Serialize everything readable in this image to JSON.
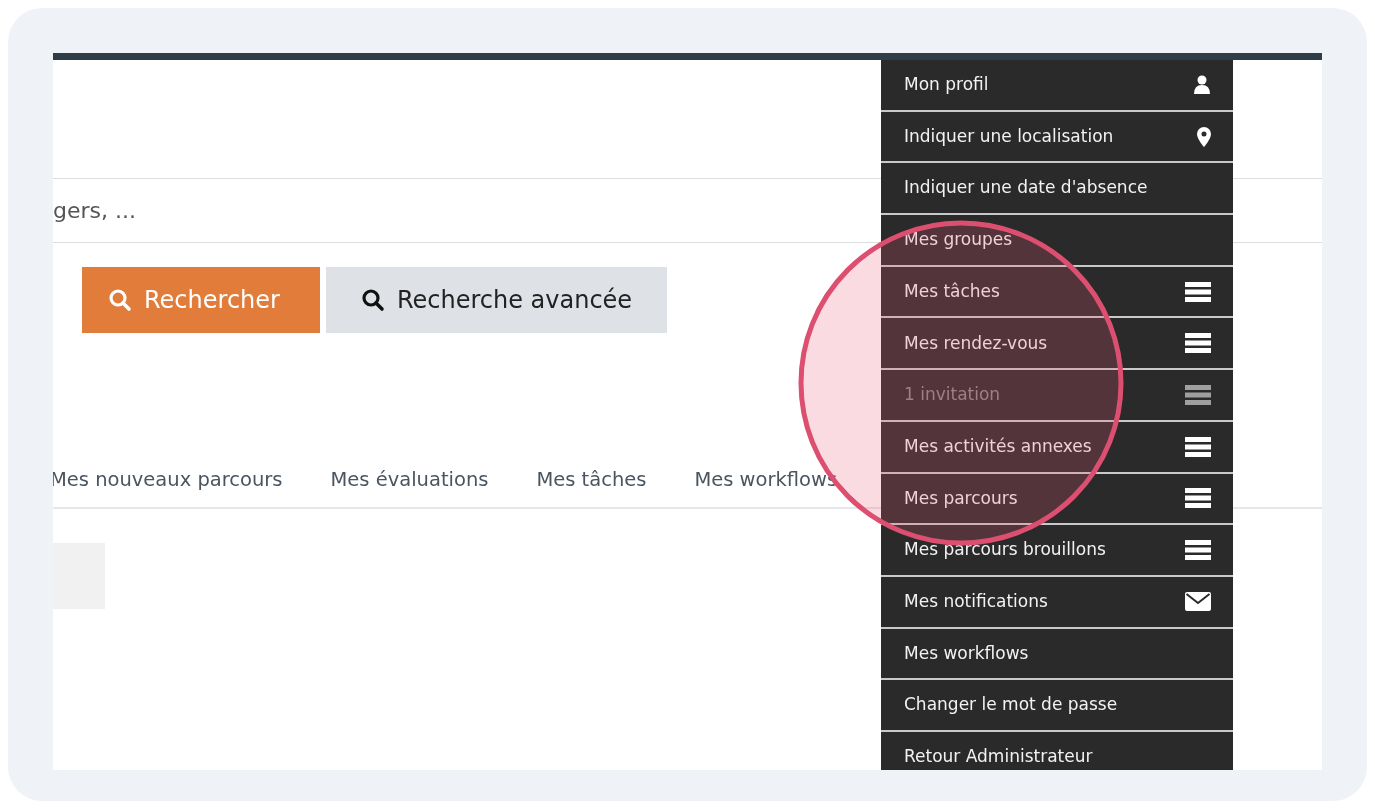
{
  "search": {
    "placeholder": "gers, ..."
  },
  "buttons": [
    {
      "label": "Rechercher",
      "kind": "primary"
    },
    {
      "label": "Recherche avancée",
      "kind": "secondary"
    }
  ],
  "tabs": [
    {
      "label": "Mes nouveaux parcours"
    },
    {
      "label": "Mes évaluations"
    },
    {
      "label": "Mes tâches"
    },
    {
      "label": "Mes workflows"
    }
  ],
  "user_menu": {
    "items": [
      {
        "label": "Mon profil",
        "kind": "user",
        "disabled": false
      },
      {
        "label": "Indiquer une localisation",
        "kind": "pin",
        "disabled": false
      },
      {
        "label": "Indiquer une date d'absence",
        "kind": "plain",
        "disabled": false
      },
      {
        "label": "Mes groupes",
        "kind": "plain",
        "disabled": false
      },
      {
        "label": "Mes tâches",
        "kind": "list",
        "disabled": false
      },
      {
        "label": "Mes rendez-vous",
        "kind": "list",
        "disabled": false
      },
      {
        "label": "1 invitation",
        "kind": "list",
        "disabled": true
      },
      {
        "label": "Mes activités annexes",
        "kind": "list",
        "disabled": false
      },
      {
        "label": "Mes parcours",
        "kind": "list",
        "disabled": false
      },
      {
        "label": "Mes parcours brouillons",
        "kind": "list",
        "disabled": false
      },
      {
        "label": "Mes notifications",
        "kind": "mail",
        "disabled": false
      },
      {
        "label": "Mes workflows",
        "kind": "plain",
        "disabled": false
      },
      {
        "label": "Changer le mot de passe",
        "kind": "plain",
        "disabled": false
      },
      {
        "label": "Retour Administrateur",
        "kind": "plain",
        "disabled": false
      }
    ]
  }
}
